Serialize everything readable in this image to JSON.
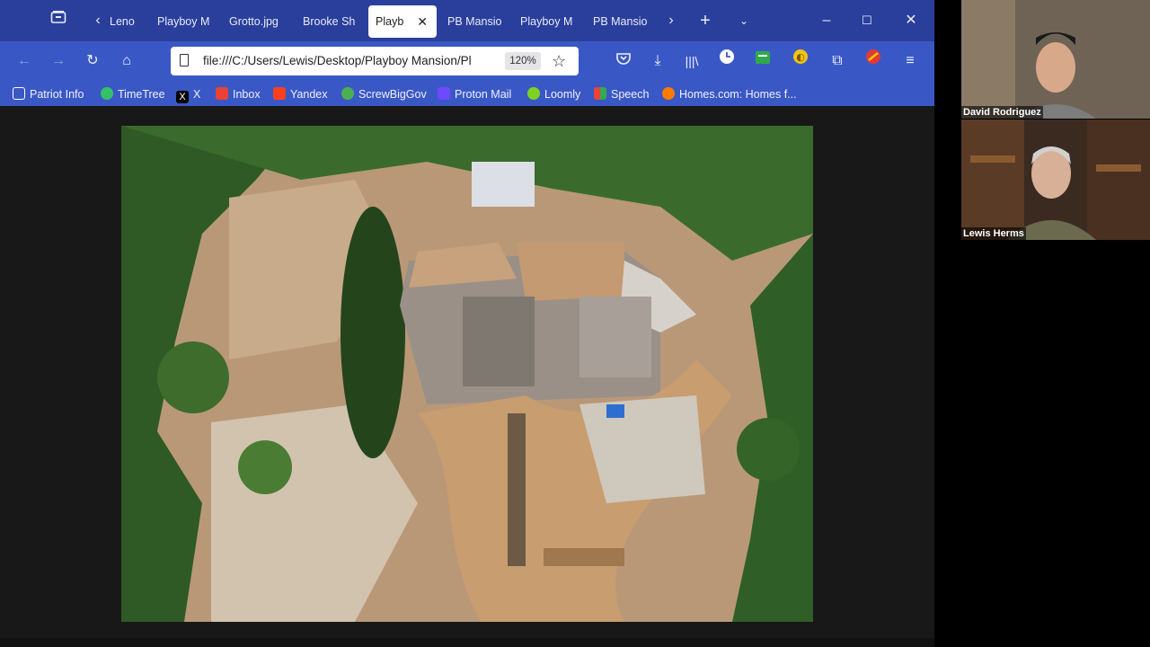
{
  "tabs": [
    {
      "label": "Leno"
    },
    {
      "label": "Playboy M"
    },
    {
      "label": "Grotto.jpg"
    },
    {
      "label": "Brooke Sh"
    },
    {
      "label": "Playb"
    },
    {
      "label": "PB Mansio"
    },
    {
      "label": "Playboy M"
    },
    {
      "label": "PB Mansio"
    }
  ],
  "address": {
    "url": "file:///C:/Users/Lewis/Desktop/Playboy Mansion/Pl",
    "zoom": "120%"
  },
  "bookmarks": [
    {
      "label": "Patriot Info",
      "color": "#ffffff"
    },
    {
      "label": "TimeTree",
      "color": "#35c06a"
    },
    {
      "label": "X",
      "color": "#000000"
    },
    {
      "label": "Inbox",
      "color": "#ea4335"
    },
    {
      "label": "Yandex",
      "color": "#fc3f1d"
    },
    {
      "label": "ScrewBigGov",
      "color": "#4caf50"
    },
    {
      "label": "Proton Mail",
      "color": "#6d4aff"
    },
    {
      "label": "Loomly",
      "color": "#7ed321"
    },
    {
      "label": "Speech",
      "color": "#f4b400"
    },
    {
      "label": "Homes.com: Homes f...",
      "color": "#ff7a00"
    }
  ],
  "participants": [
    {
      "name": "David Rodriguez"
    },
    {
      "name": "Lewis Herms"
    }
  ],
  "colors": {
    "tabbar": "#2a3f9c",
    "toolbar": "#3a58c5",
    "accent": "#ffffff"
  }
}
